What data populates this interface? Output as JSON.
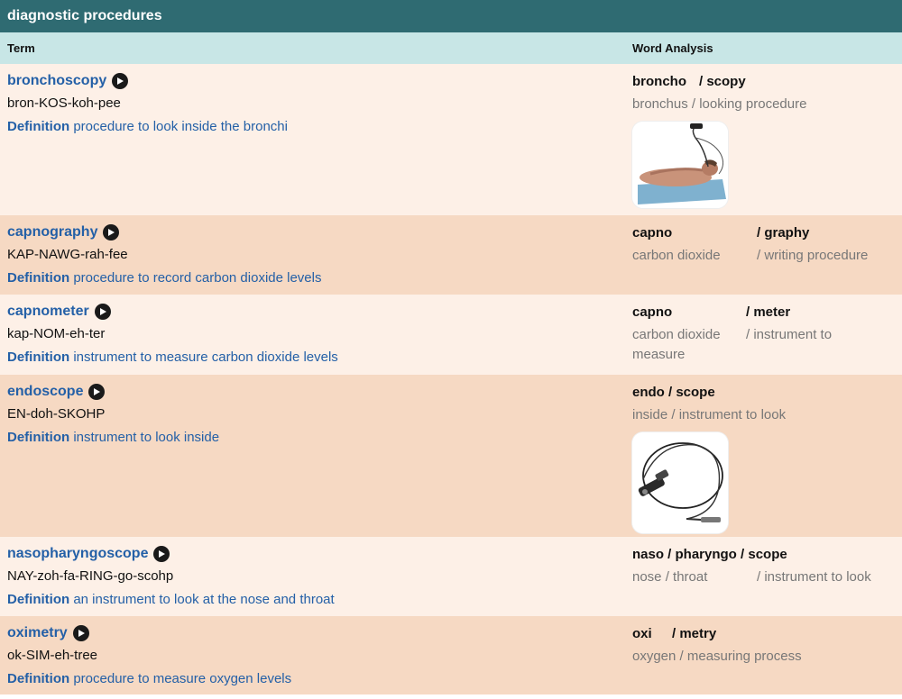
{
  "table": {
    "title": "diagnostic procedures",
    "col_term": "Term",
    "col_analysis": "Word Analysis",
    "definition_label": "Definition"
  },
  "colors": {
    "title_bg": "#2f6b72",
    "header_bg": "#c8e6e6",
    "row_light": "#fdf0e7",
    "row_dark": "#f6d9c3",
    "link": "#2460a7"
  },
  "rows": [
    {
      "term": "bronchoscopy",
      "pronunciation": "bron-KOS-koh-pee",
      "definition": "procedure to look inside the bronchi",
      "parts": [
        "broncho",
        "/ scopy"
      ],
      "meanings": [
        "bronchus / looking procedure"
      ],
      "image": "bronchoscopy-patient-illustration"
    },
    {
      "term": "capnography",
      "pronunciation": "KAP-NAWG-rah-fee",
      "definition": "procedure to record carbon dioxide levels",
      "parts": [
        "capno",
        "/ graphy"
      ],
      "meanings": [
        "carbon dioxide",
        "/ writing procedure"
      ]
    },
    {
      "term": "capnometer",
      "pronunciation": "kap-NOM-eh-ter",
      "definition": "instrument to measure carbon dioxide levels",
      "parts": [
        "capno",
        "/ meter"
      ],
      "meanings": [
        "carbon dioxide",
        "/ instrument to",
        "measure"
      ]
    },
    {
      "term": "endoscope",
      "pronunciation": "EN-doh-SKOHP",
      "definition": "instrument to look inside",
      "parts": [
        "endo / scope"
      ],
      "meanings": [
        "inside / instrument to look"
      ],
      "image": "endoscope-instrument-photo"
    },
    {
      "term": "nasopharyngoscope",
      "pronunciation": "NAY-zoh-fa-RING-go-scohp",
      "definition": "an instrument to look at the nose and throat",
      "parts": [
        "naso / pharyngo / scope"
      ],
      "meanings": [
        "nose / throat",
        "/ instrument to look"
      ]
    },
    {
      "term": "oximetry",
      "pronunciation": "ok-SIM-eh-tree",
      "definition": "procedure to measure oxygen levels",
      "parts": [
        "oxi",
        "/ metry"
      ],
      "meanings": [
        "oxygen / measuring process"
      ]
    }
  ]
}
